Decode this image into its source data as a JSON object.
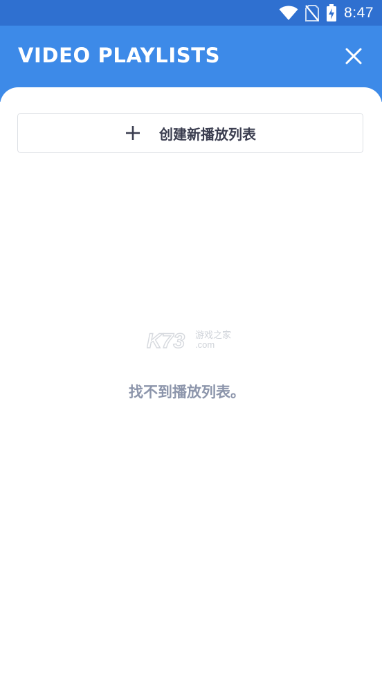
{
  "status_bar": {
    "time": "8:47",
    "icons": [
      "wifi-icon",
      "no-sim-icon",
      "battery-charging-icon"
    ]
  },
  "header": {
    "title": "VIDEO PLAYLISTS",
    "close_icon": "close-icon"
  },
  "create_button": {
    "icon": "plus-icon",
    "label": "创建新播放列表"
  },
  "empty_state": {
    "message": "找不到播放列表。"
  },
  "watermark": {
    "logo_text": "K73",
    "subtitle": "游戏之家",
    "domain": ".com"
  },
  "colors": {
    "status_bar": "#2f70d0",
    "header": "#3d8ae8",
    "empty_text": "#8c95ab",
    "button_text": "#3a3d4f"
  }
}
